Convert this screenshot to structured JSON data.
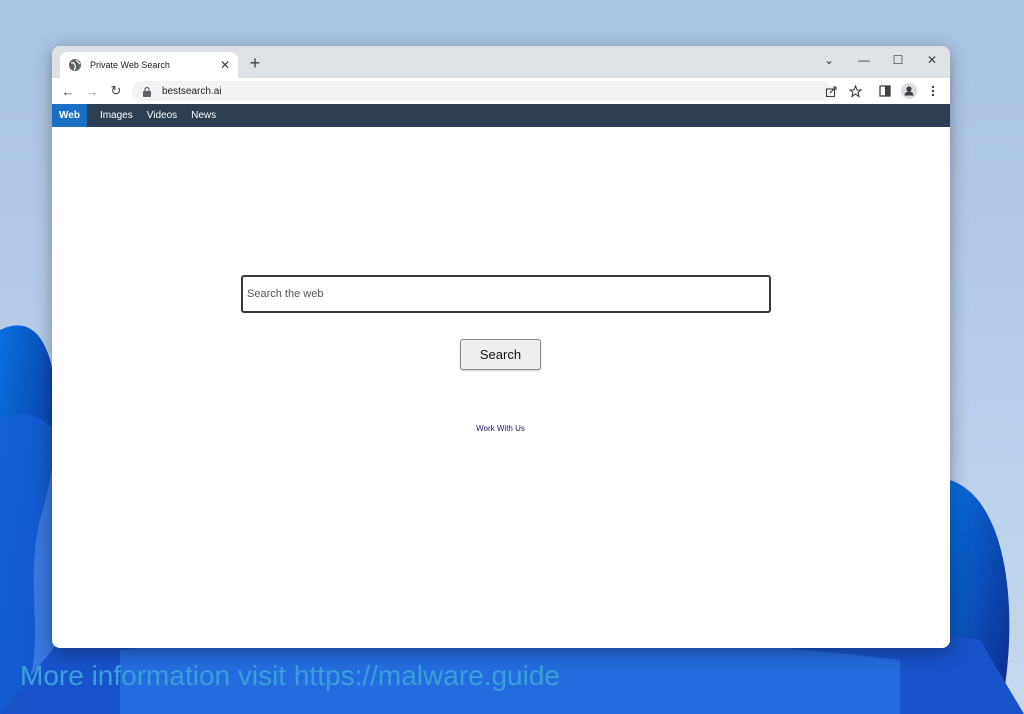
{
  "tab": {
    "title": "Private Web Search",
    "close": "✕"
  },
  "new_tab": "+",
  "window_controls": {
    "dropdown": "⌄",
    "minimize": "—",
    "maximize": "☐",
    "close": "✕"
  },
  "nav": {
    "back": "←",
    "forward": "→",
    "reload": "↻"
  },
  "address_bar": {
    "url": "bestsearch.ai"
  },
  "toolbar_icons": [
    "share-icon",
    "star-icon",
    "sidepanel-icon",
    "profile-icon",
    "menu-icon"
  ],
  "site_nav": {
    "items": [
      {
        "label": "Web",
        "active": true
      },
      {
        "label": "Images",
        "active": false
      },
      {
        "label": "Videos",
        "active": false
      },
      {
        "label": "News",
        "active": false
      }
    ]
  },
  "search": {
    "placeholder": "Search the web",
    "value": "",
    "button_label": "Search"
  },
  "footer_link": "Work With Us",
  "watermark": "More information visit https://malware.guide",
  "colors": {
    "site_nav_bg": "#2c3e50",
    "active_tab": "#1a6fc4",
    "watermark": "#3aa0d8"
  }
}
